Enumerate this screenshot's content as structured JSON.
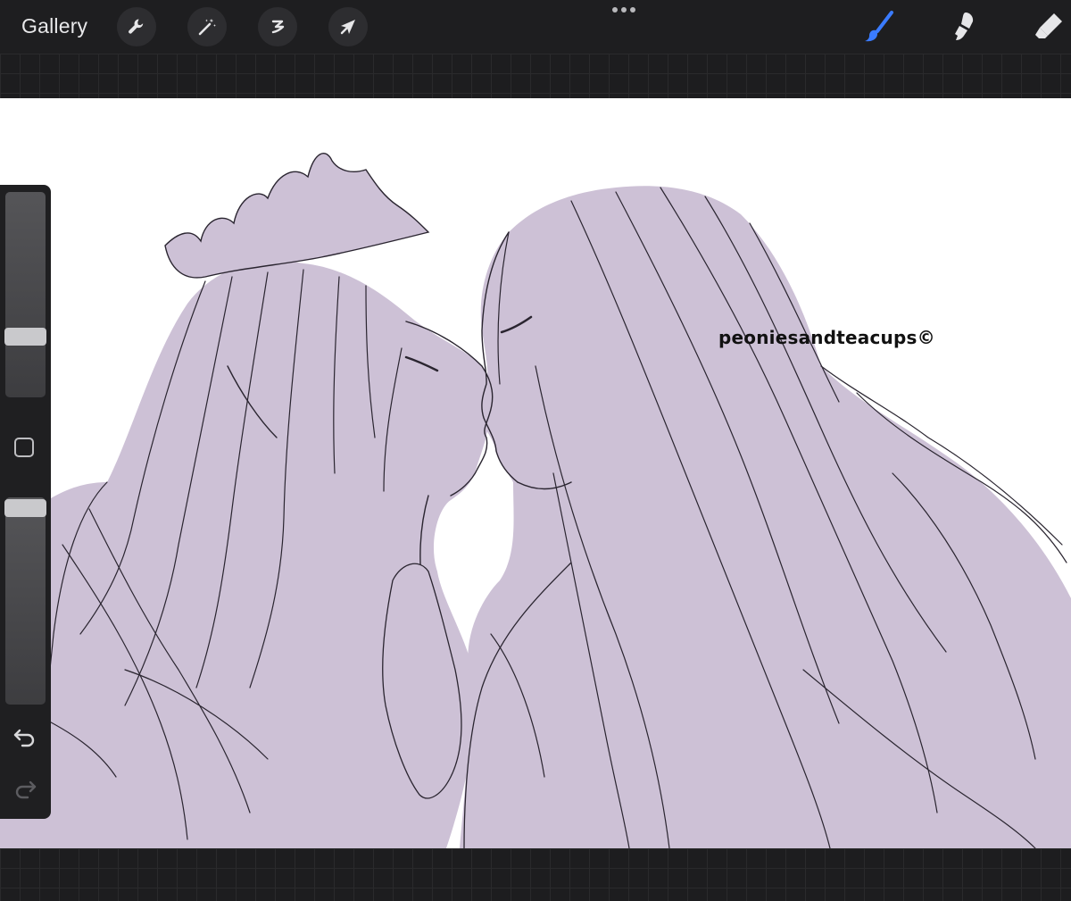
{
  "toolbar": {
    "gallery_label": "Gallery",
    "left_tools": [
      {
        "icon": "wrench-icon",
        "name": "Actions"
      },
      {
        "icon": "magic-wand-icon",
        "name": "Adjustments"
      },
      {
        "icon": "selection-icon",
        "name": "Selection"
      },
      {
        "icon": "arrow-cursor-icon",
        "name": "Transform"
      }
    ],
    "right_tools": [
      {
        "icon": "brush-icon",
        "name": "Paint",
        "active": true
      },
      {
        "icon": "smudge-icon",
        "name": "Smudge",
        "active": false
      },
      {
        "icon": "eraser-icon",
        "name": "Erase",
        "active": false
      }
    ],
    "active_color": "#3a7bff",
    "icon_color": "#e6e6e8"
  },
  "canvas": {
    "watermark": "peoniesandteacups©",
    "fill_color": "#cdc1d6",
    "line_color": "#2a2530"
  },
  "sidebar": {
    "brush_size": 0.68,
    "brush_opacity": 0.94
  }
}
